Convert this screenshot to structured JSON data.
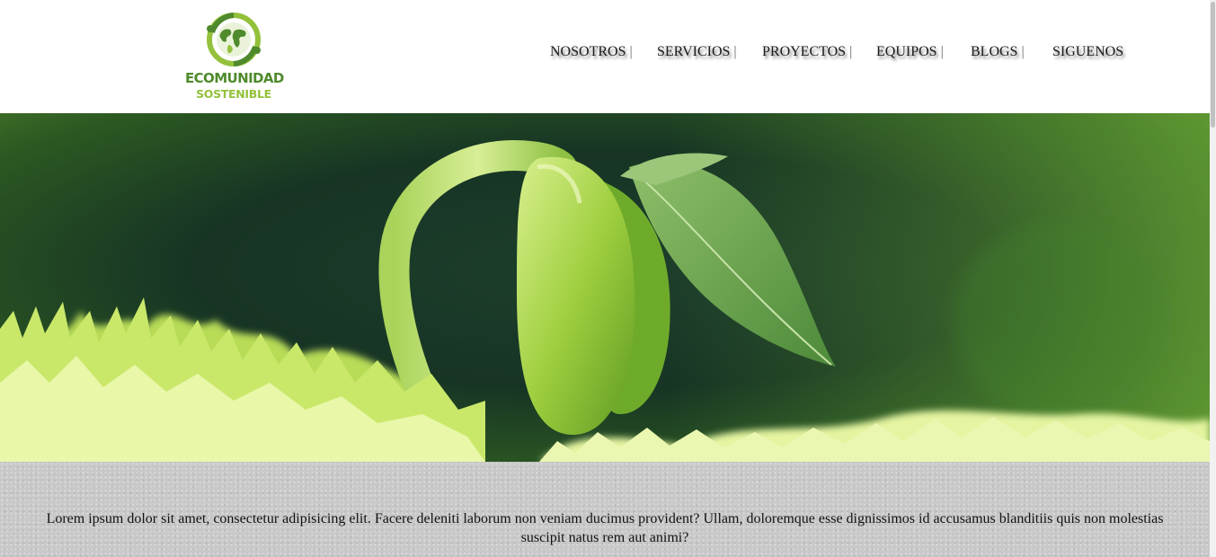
{
  "brand": {
    "line1": "ECOMUNIDAD",
    "line2": "SOSTENIBLE",
    "colors": {
      "dark_green": "#4f8a2c",
      "light_green": "#93c13b"
    },
    "icon": "globe-recycle-icon"
  },
  "nav": {
    "items": [
      {
        "label": "NOSOTROS",
        "sep": "|"
      },
      {
        "label": "SERVICIOS",
        "sep": "|"
      },
      {
        "label": "PROYECTOS",
        "sep": "|"
      },
      {
        "label": "EQUIPOS",
        "sep": "|"
      },
      {
        "label": "BLOGS",
        "sep": "|"
      },
      {
        "label": "SIGUENOS",
        "sep": ""
      }
    ]
  },
  "hero": {
    "image": "sprouting-seedling-photo"
  },
  "content": {
    "text": "Lorem ipsum dolor sit amet, consectetur adipisicing elit. Facere deleniti laborum non veniam ducimus provident? Ullam, doloremque esse dignissimos id accusamus blanditiis quis non molestias suscipit natus rem aut animi?"
  }
}
